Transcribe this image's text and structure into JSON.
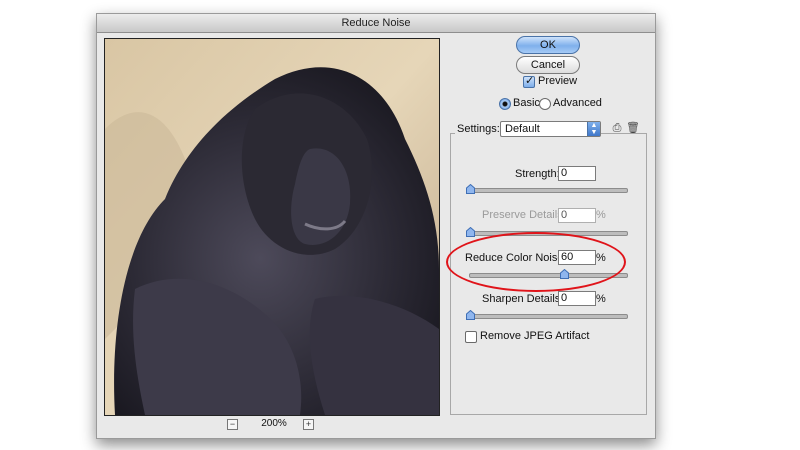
{
  "window": {
    "title": "Reduce Noise"
  },
  "preview": {
    "zoom_level": "200%",
    "zoom_out": "−",
    "zoom_in": "+"
  },
  "buttons": {
    "ok": "OK",
    "cancel": "Cancel"
  },
  "preview_toggle": {
    "label": "Preview",
    "checked": true
  },
  "mode": {
    "basic": "Basic",
    "advanced": "Advanced",
    "selected": "Basic"
  },
  "settings": {
    "label": "Settings:",
    "value": "Default"
  },
  "controls": {
    "strength": {
      "label": "Strength:",
      "value": "0",
      "unit": "",
      "level": 0
    },
    "preserve_details": {
      "label": "Preserve Details:",
      "value": "0",
      "unit": "%",
      "level": 0,
      "disabled": true
    },
    "reduce_color_noise": {
      "label": "Reduce Color Noise:",
      "value": "60",
      "unit": "%",
      "level": 0.6
    },
    "sharpen_details": {
      "label": "Sharpen Details:",
      "value": "0",
      "unit": "%",
      "level": 0
    }
  },
  "jpeg_artifact": {
    "label": "Remove JPEG Artifact",
    "checked": false
  },
  "colors": {
    "highlight": "#e0141a",
    "default_button": "#7fb0ec"
  }
}
